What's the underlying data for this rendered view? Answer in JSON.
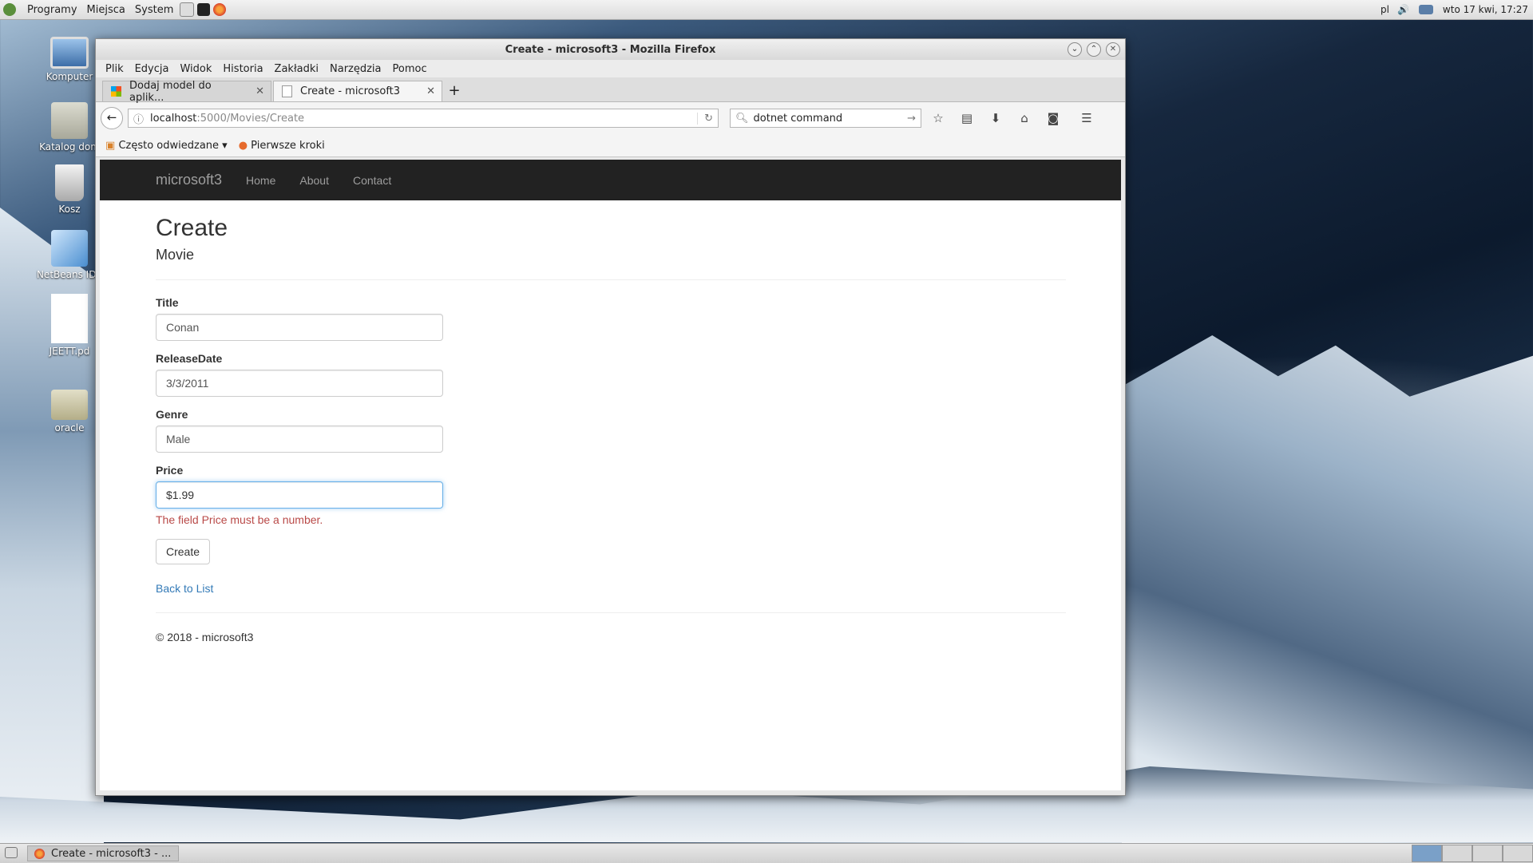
{
  "top_panel": {
    "menus": [
      "Programy",
      "Miejsca",
      "System"
    ],
    "lang": "pl",
    "clock": "wto 17 kwi, 17:27"
  },
  "desktop_icons": [
    {
      "label": "Komputer",
      "icon": "computer-icon"
    },
    {
      "label": "Katalog dom",
      "icon": "home-folder-icon"
    },
    {
      "label": "Kosz",
      "icon": "trash-icon"
    },
    {
      "label": "NetBeans IDE",
      "icon": "netbeans-icon"
    },
    {
      "label": "JEETT.pd",
      "icon": "pdf-document-icon"
    },
    {
      "label": "oracle",
      "icon": "folder-icon"
    }
  ],
  "window": {
    "title": "Create - microsoft3 - Mozilla Firefox",
    "menu": [
      "Plik",
      "Edycja",
      "Widok",
      "Historia",
      "Zakładki",
      "Narzędzia",
      "Pomoc"
    ],
    "tabs": [
      {
        "label": "Dodaj model do aplik...",
        "active": false
      },
      {
        "label": "Create - microsoft3",
        "active": true
      }
    ],
    "url_host": "localhost",
    "url_path": ":5000/Movies/Create",
    "search_value": "dotnet command",
    "bookmarks": [
      "Często odwiedzane ▾",
      "Pierwsze kroki"
    ]
  },
  "site": {
    "brand": "microsoft3",
    "nav": [
      "Home",
      "About",
      "Contact"
    ],
    "heading": "Create",
    "subheading": "Movie",
    "fields": [
      {
        "label": "Title",
        "value": "Conan"
      },
      {
        "label": "ReleaseDate",
        "value": "3/3/2011"
      },
      {
        "label": "Genre",
        "value": "Male"
      },
      {
        "label": "Price",
        "value": "$1.99"
      }
    ],
    "price_error": "The field Price must be a number.",
    "create_button": "Create",
    "back_link": "Back to List",
    "footer": "© 2018 - microsoft3"
  },
  "taskbar": {
    "task": "Create - microsoft3 - ..."
  }
}
